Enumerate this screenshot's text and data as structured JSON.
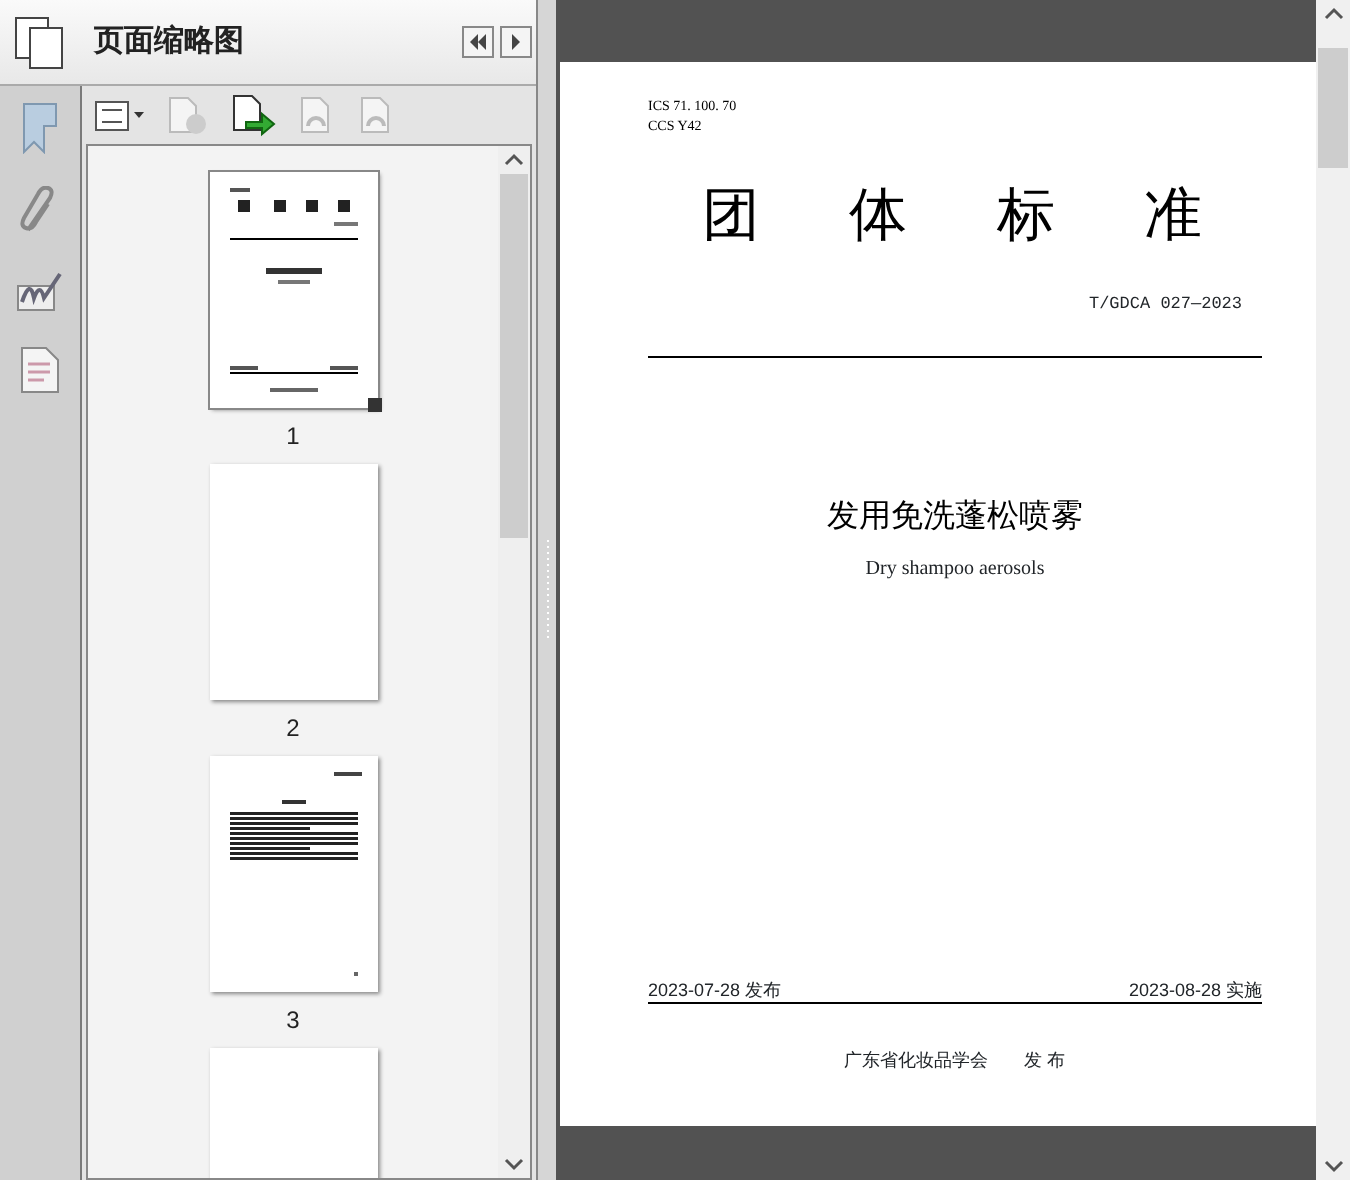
{
  "panel": {
    "title": "页面缩略图"
  },
  "thumbnails": [
    {
      "kind": "cover",
      "label": "1",
      "selected": true
    },
    {
      "kind": "blank",
      "label": "2",
      "selected": false
    },
    {
      "kind": "text",
      "label": "3",
      "selected": false
    },
    {
      "kind": "blank",
      "selected": false
    }
  ],
  "document": {
    "ics": "ICS  71. 100. 70",
    "ccs": "CCS  Y42",
    "title_chars": [
      "团",
      "体",
      "标",
      "准"
    ],
    "code": "T/GDCA 027—2023",
    "title_zh": "发用免洗蓬松喷雾",
    "title_en": "Dry shampoo aerosols",
    "publish_date": "2023-07-28 发布",
    "effective_date": "2023-08-28 实施",
    "publisher": "广东省化妆品学会",
    "publish_word": "发 布"
  }
}
